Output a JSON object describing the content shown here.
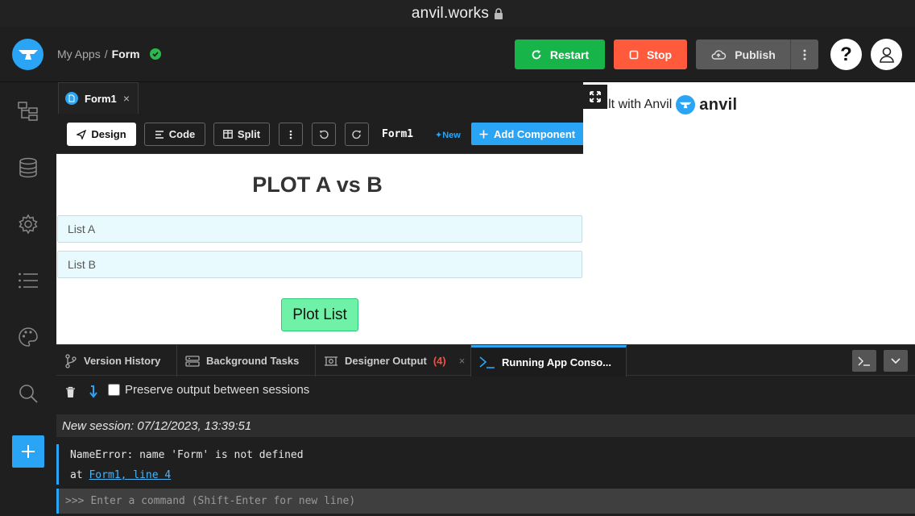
{
  "browser": {
    "url": "anvil.works",
    "lock_icon": "lock-icon"
  },
  "header": {
    "breadcrumb_root": "My Apps",
    "breadcrumb_sep": "/",
    "app_name": "Form",
    "restart_label": "Restart",
    "stop_label": "Stop",
    "publish_label": "Publish",
    "help_label": "?"
  },
  "sidebar": {
    "icons": [
      "app-tree-icon",
      "database-icon",
      "gear-icon",
      "list-icon",
      "palette-icon",
      "search-icon"
    ],
    "add_label": "+"
  },
  "editor": {
    "tab_label": "Form1",
    "tab_close": "×",
    "design_label": "Design",
    "code_label": "Code",
    "split_label": "Split",
    "form_name": "Form1",
    "new_badge": "New",
    "add_component_label": "Add Component"
  },
  "form": {
    "title": "PLOT A vs B",
    "list_a_placeholder": "List A",
    "list_b_placeholder": "List B",
    "plot_button_label": "Plot List"
  },
  "preview": {
    "built_with": "Built with Anvil",
    "brand_word": "anvil"
  },
  "bottom": {
    "tabs": [
      {
        "label": "Version History"
      },
      {
        "label": "Background Tasks"
      },
      {
        "label": "Designer Output",
        "count": "(4)"
      },
      {
        "label": "Running App Conso..."
      }
    ],
    "designer_output_close": "×",
    "preserve_label": "Preserve output between sessions",
    "session_line": "New session: 07/12/2023, 13:39:51",
    "error_text": "NameError: name 'Form' is not defined",
    "error_at": "at",
    "error_link": "Form1, line 4",
    "prompt": ">>>",
    "command_placeholder": "Enter a command (Shift-Enter for new line)"
  },
  "colors": {
    "accent": "#2aa4f4",
    "restart": "#17b44a",
    "stop": "#ff5a3c",
    "error_count": "#ff4a3c",
    "input_bg": "#e9fafe",
    "plot_button": "#6ff2a7"
  }
}
